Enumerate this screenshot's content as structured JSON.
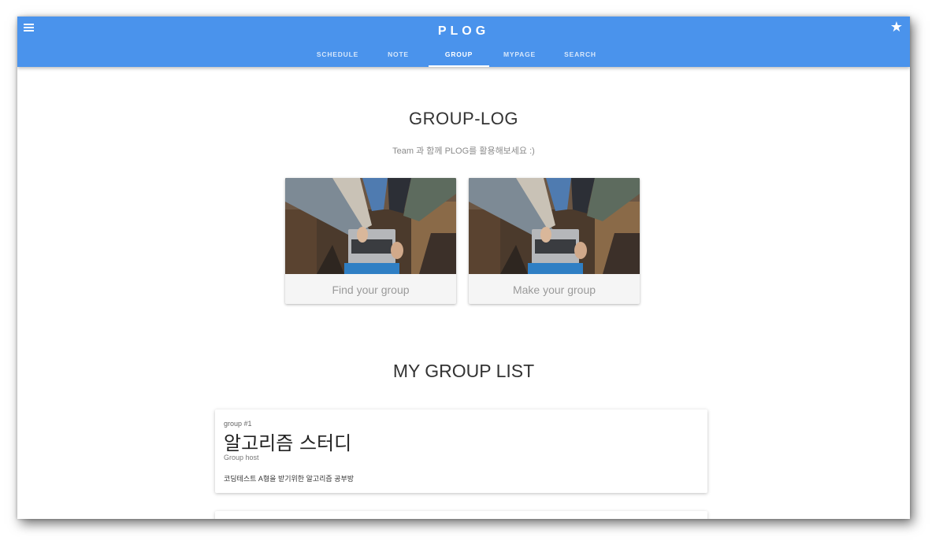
{
  "app": {
    "brand": "PLOG",
    "tabs": [
      {
        "label": "SCHEDULE"
      },
      {
        "label": "NOTE"
      },
      {
        "label": "GROUP"
      },
      {
        "label": "MYPAGE"
      },
      {
        "label": "SEARCH"
      }
    ],
    "active_tab": "GROUP",
    "accent_color": "#4a93ec",
    "left_icon": "menu-icon",
    "right_icon": "star-icon"
  },
  "grouplog": {
    "title": "GROUP-LOG",
    "subtitle": "Team 과 함께 PLOG를 활용해보세요 :)",
    "cards": [
      {
        "label": "Find your group",
        "image": "laptop-teamwork-photo"
      },
      {
        "label": "Make your group",
        "image": "laptop-teamwork-photo"
      }
    ]
  },
  "my_group_list": {
    "title": "MY GROUP LIST",
    "groups": [
      {
        "number": "group #1",
        "name": "알고리즘 스터디",
        "host": "Group host",
        "description": "코딩테스트 A형을 받기위한 알고리즘 공부방"
      }
    ]
  }
}
